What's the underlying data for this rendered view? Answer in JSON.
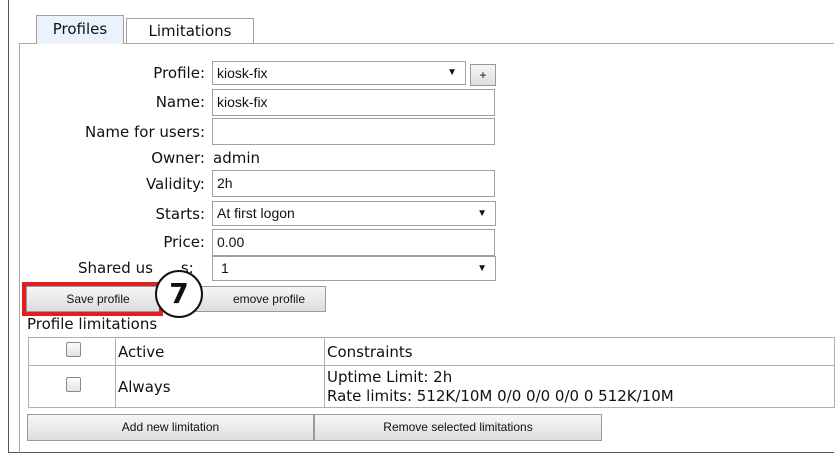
{
  "tabs": [
    {
      "label": "Profiles"
    },
    {
      "label": "Limitations"
    }
  ],
  "form": {
    "profile": {
      "label": "Profile:",
      "value": "kiosk-fix",
      "add_label": "+"
    },
    "name": {
      "label": "Name:",
      "value": "kiosk-fix"
    },
    "name_for_users": {
      "label": "Name for users:",
      "value": ""
    },
    "owner": {
      "label": "Owner:",
      "value": "admin"
    },
    "validity": {
      "label": "Validity:",
      "value": "2h"
    },
    "starts": {
      "label": "Starts:",
      "value": "At first logon"
    },
    "price": {
      "label": "Price:",
      "value": "0.00"
    },
    "shared_users": {
      "label_visible": "Shared us",
      "label_tail": "s:",
      "value": "1"
    }
  },
  "buttons": {
    "save_profile": "Save profile",
    "remove_profile": "emove profile"
  },
  "callout": {
    "number": "7"
  },
  "limitations": {
    "title": "Profile limitations",
    "headers": {
      "active": "Active",
      "constraints": "Constraints"
    },
    "rows": [
      {
        "active": "Always",
        "constraint_1": "Uptime Limit: 2h",
        "constraint_2": "Rate limits: 512K/10M 0/0 0/0 0/0 0 512K/10M"
      }
    ],
    "add_label": "Add new limitation",
    "remove_label": "Remove selected limitations"
  },
  "colors": {
    "highlight": "#e02020",
    "active_tab": "#eaf3fb"
  }
}
